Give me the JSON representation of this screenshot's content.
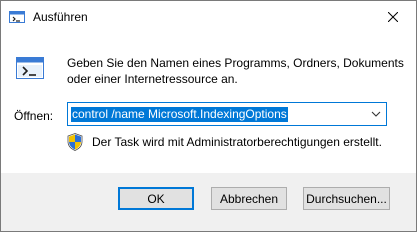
{
  "window": {
    "title": "Ausführen",
    "close_icon": "close-icon"
  },
  "dialog": {
    "description": "Geben Sie den Namen eines Programms, Ordners, Dokuments oder einer Internetressource an.",
    "open_label": "Öffnen:",
    "open_value": "control /name Microsoft.IndexingOptions",
    "admin_notice": "Der Task wird mit Administratorberechtigungen erstellt."
  },
  "buttons": {
    "ok": "OK",
    "cancel": "Abbrechen",
    "browse": "Durchsuchen..."
  },
  "colors": {
    "accent": "#0078d7",
    "footer_bg": "#f0f0f0",
    "button_bg": "#e1e1e1"
  }
}
